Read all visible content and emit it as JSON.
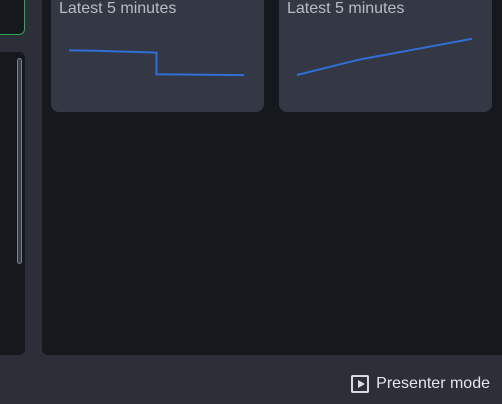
{
  "cards": [
    {
      "title": "Latest 5 minutes",
      "series": [
        [
          0,
          0.78
        ],
        [
          0.15,
          0.77
        ],
        [
          0.5,
          0.72
        ],
        [
          0.5,
          0.15
        ],
        [
          1,
          0.13
        ]
      ]
    },
    {
      "title": "Latest 5 minutes",
      "series": [
        [
          0,
          0.12
        ],
        [
          0.35,
          0.48
        ],
        [
          1,
          0.98
        ]
      ]
    }
  ],
  "footer": {
    "presenter_label": "Presenter mode",
    "icon": "play-in-square-icon"
  },
  "colors": {
    "line": "#2f6fd6",
    "card": "#343844",
    "panel": "#15181d",
    "background": "#2c2f38"
  }
}
